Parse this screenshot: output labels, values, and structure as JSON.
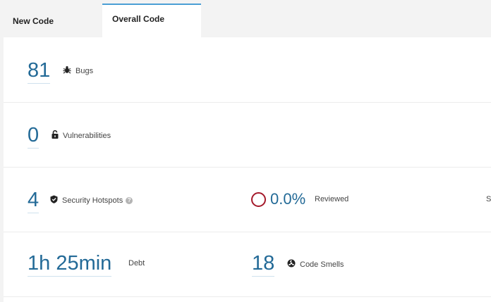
{
  "tabs": {
    "new_code": "New Code",
    "overall_code": "Overall Code"
  },
  "bugs": {
    "value": "81",
    "label": "Bugs",
    "icon": "bug-icon"
  },
  "vulnerabilities": {
    "value": "0",
    "label": "Vulnerabilities",
    "icon": "lock-open-icon"
  },
  "hotspots": {
    "value": "4",
    "label": "Security Hotspots",
    "icon": "shield-icon",
    "help": "?",
    "reviewed_value": "0.0%",
    "reviewed_label": "Reviewed",
    "truncated_text": "S",
    "rating_color": "#a4192a"
  },
  "maintainability": {
    "debt_value": "1h 25min",
    "debt_label": "Debt",
    "smells_value": "18",
    "smells_label": "Code Smells",
    "icon": "code-smell-icon"
  },
  "colors": {
    "accent": "#4b9fd5",
    "metric": "#236a97"
  }
}
